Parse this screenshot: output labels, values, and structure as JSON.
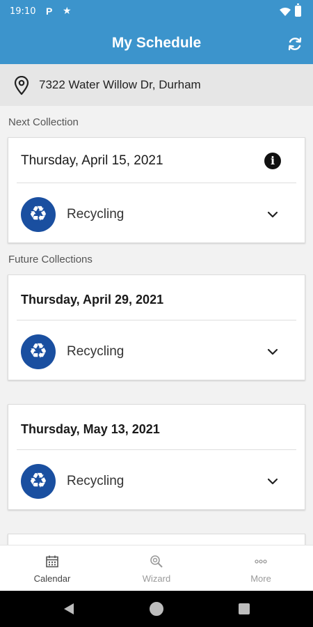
{
  "status_bar": {
    "time": "19:10",
    "p_glyph": "P",
    "star_glyph": "★"
  },
  "app_bar": {
    "title": "My Schedule",
    "refresh_icon": "refresh-icon"
  },
  "address": {
    "text": "7322 Water Willow Dr, Durham",
    "icon": "pin-icon"
  },
  "next_collection": {
    "label": "Next Collection",
    "date": "Thursday, April 15, 2021",
    "info_glyph": "i",
    "waste_type": "Recycling",
    "badge_glyph": "♻"
  },
  "future_collections": {
    "label": "Future Collections",
    "items": [
      {
        "date": "Thursday, April 29, 2021",
        "waste_type": "Recycling",
        "badge_glyph": "♻"
      },
      {
        "date": "Thursday, May 13, 2021",
        "waste_type": "Recycling",
        "badge_glyph": "♻"
      }
    ]
  },
  "bottom_nav": {
    "items": [
      {
        "label": "Calendar",
        "icon": "calendar-icon",
        "active": true
      },
      {
        "label": "Wizard",
        "icon": "wizard-search-icon",
        "active": false
      },
      {
        "label": "More",
        "icon": "more-dots-icon",
        "active": false
      }
    ]
  },
  "colors": {
    "primary": "#3c94cc",
    "recycle_badge": "#1a4fa0",
    "background": "#f2f2f2"
  }
}
